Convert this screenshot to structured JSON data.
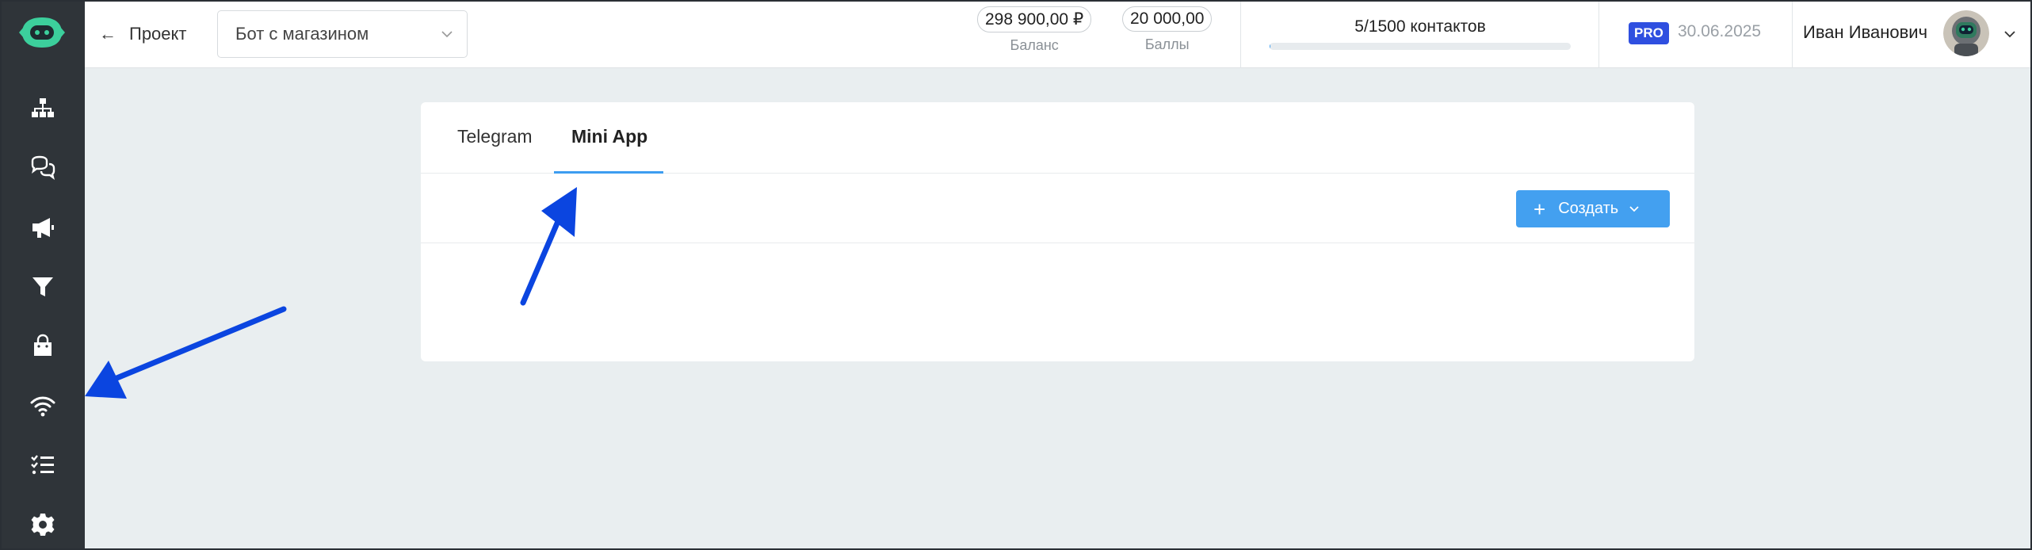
{
  "sidebar": {
    "items": [
      {
        "name": "sitemap-icon"
      },
      {
        "name": "chat-bubbles-icon"
      },
      {
        "name": "megaphone-icon"
      },
      {
        "name": "filter-icon"
      },
      {
        "name": "shopping-bag-icon"
      },
      {
        "name": "wifi-icon"
      },
      {
        "name": "checklist-icon"
      },
      {
        "name": "gear-icon"
      }
    ]
  },
  "header": {
    "back_label": "Проект",
    "project_select": "Бот с магазином",
    "balance_value": "298 900,00 ₽",
    "balance_label": "Баланс",
    "points_value": "20 000,00",
    "points_label": "Баллы",
    "contacts_text": "5/1500 контактов",
    "contacts_progress": 0.003,
    "plan_badge": "PRO",
    "plan_date": "30.06.2025",
    "user_name": "Иван Иванович"
  },
  "main": {
    "tabs": [
      {
        "label": "Telegram",
        "active": false
      },
      {
        "label": "Mini App",
        "active": true
      }
    ],
    "create_button": "Создать"
  },
  "colors": {
    "sidebar_bg": "#2f3439",
    "accent": "#43a0f0",
    "pro_badge": "#2f4fe0",
    "annotation_arrow": "#0b45e0",
    "page_bg": "#e9eef0"
  }
}
